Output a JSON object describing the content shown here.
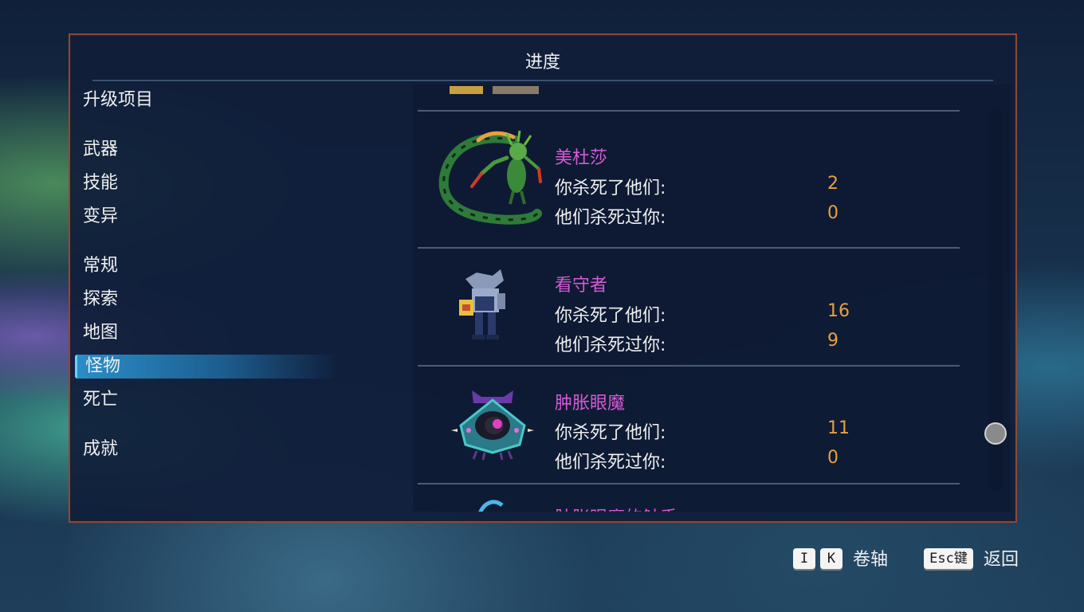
{
  "panel": {
    "title": "进度"
  },
  "nav": {
    "upgrades": "升级项目",
    "weapons": "武器",
    "skills": "技能",
    "mutations": "变异",
    "general": "常规",
    "exploration": "探索",
    "map": "地图",
    "monsters": "怪物",
    "deaths": "死亡",
    "achievements": "成就",
    "active": "怪物"
  },
  "monsters": [
    {
      "name": "美杜莎",
      "killed_label": "你杀死了他们:",
      "killed": "2",
      "deaths_label": "他们杀死过你:",
      "deaths": "0"
    },
    {
      "name": "看守者",
      "killed_label": "你杀死了他们:",
      "killed": "16",
      "deaths_label": "他们杀死过你:",
      "deaths": "9"
    },
    {
      "name": "肿胀眼魔",
      "killed_label": "你杀死了他们:",
      "killed": "11",
      "deaths_label": "他们杀死过你:",
      "deaths": "0"
    },
    {
      "name": "肿胀眼魔的触手"
    }
  ],
  "footer": {
    "key_i": "I",
    "key_k": "K",
    "scroll_label": "卷轴",
    "key_esc": "Esc键",
    "back_label": "返回"
  },
  "colors": {
    "monster_name": "#d45ad4",
    "stat_value": "#e8a040",
    "nav_active": "#2a8ec8",
    "panel_border": "#8a4a3a"
  }
}
